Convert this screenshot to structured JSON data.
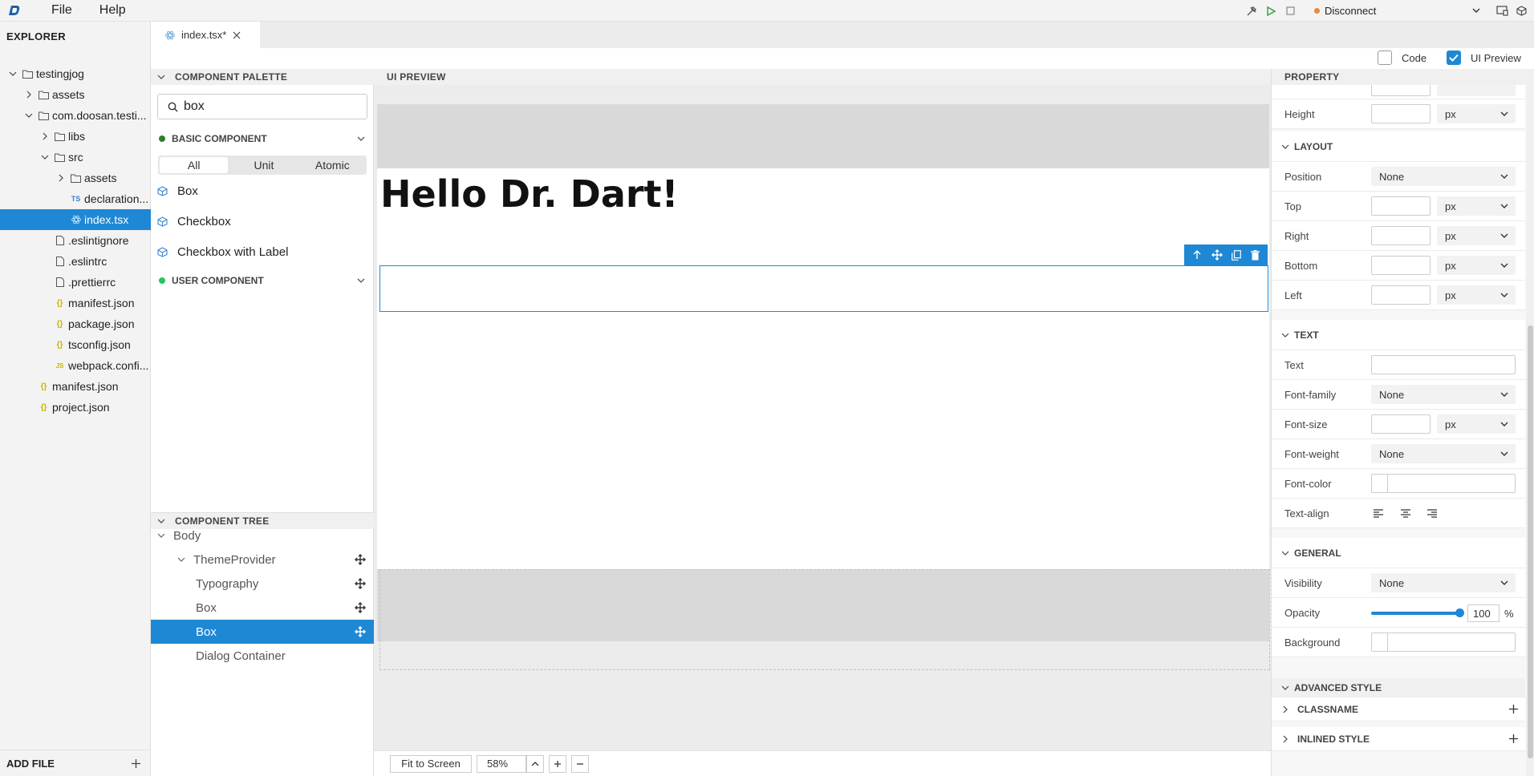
{
  "menu": {
    "file": "File",
    "help": "Help"
  },
  "connection": {
    "label": "Disconnect"
  },
  "explorer": {
    "title": "EXPLORER",
    "tree": [
      {
        "name": "testingjog",
        "type": "folder",
        "expanded": true
      },
      {
        "name": "assets",
        "type": "folder",
        "expanded": false
      },
      {
        "name": "com.doosan.testi...",
        "type": "folder",
        "expanded": true
      },
      {
        "name": "libs",
        "type": "folder",
        "expanded": false
      },
      {
        "name": "src",
        "type": "folder",
        "expanded": true
      },
      {
        "name": "assets",
        "type": "folder",
        "expanded": false
      },
      {
        "name": "declaration...",
        "type": "ts"
      },
      {
        "name": "index.tsx",
        "type": "react",
        "selected": true
      },
      {
        "name": ".eslintignore",
        "type": "file"
      },
      {
        "name": ".eslintrc",
        "type": "file"
      },
      {
        "name": ".prettierrc",
        "type": "file"
      },
      {
        "name": "manifest.json",
        "type": "json"
      },
      {
        "name": "package.json",
        "type": "json"
      },
      {
        "name": "tsconfig.json",
        "type": "json"
      },
      {
        "name": "webpack.confi...",
        "type": "js"
      },
      {
        "name": "manifest.json",
        "type": "json"
      },
      {
        "name": "project.json",
        "type": "json"
      }
    ],
    "add_file": "ADD FILE"
  },
  "editor": {
    "tab": "index.tsx*",
    "toggles": {
      "code": "Code",
      "ui_preview": "UI Preview"
    }
  },
  "palette": {
    "title": "COMPONENT PALETTE",
    "search_value": "box",
    "basic_group": "BASIC COMPONENT",
    "filters": [
      "All",
      "Unit",
      "Atomic"
    ],
    "items": [
      "Box",
      "Checkbox",
      "Checkbox with Label"
    ],
    "user_group": "USER COMPONENT"
  },
  "component_tree": {
    "title": "COMPONENT TREE",
    "rows": [
      "Body",
      "ThemeProvider",
      "Typography",
      "Box",
      "Box",
      "Dialog Container"
    ]
  },
  "preview": {
    "title": "UI PREVIEW",
    "heading": "Hello Dr. Dart!",
    "fit_label": "Fit to Screen",
    "zoom": "58%"
  },
  "property": {
    "title": "PROPERTY",
    "height_label": "Height",
    "unit": "px",
    "none": "None",
    "layout_title": "LAYOUT",
    "layout": [
      "Position",
      "Top",
      "Right",
      "Bottom",
      "Left"
    ],
    "text_title": "TEXT",
    "text": [
      "Text",
      "Font-family",
      "Font-size",
      "Font-weight",
      "Font-color",
      "Text-align"
    ],
    "general_title": "GENERAL",
    "general": [
      "Visibility",
      "Opacity",
      "Background"
    ],
    "opacity_value": "100",
    "opacity_unit": "%",
    "advanced_title": "ADVANCED STYLE",
    "classname": "CLASSNAME",
    "inlined": "INLINED STYLE"
  },
  "colors": {
    "accent": "#1e88d5",
    "disconnect_dot": "#e8893a",
    "basic_dot": "#2e7d32",
    "user_dot": "#22c55e"
  }
}
